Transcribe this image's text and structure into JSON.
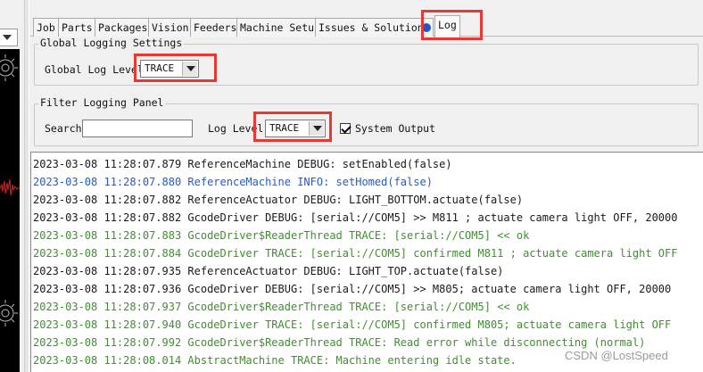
{
  "tabs": [
    {
      "label": "Job"
    },
    {
      "label": "Parts"
    },
    {
      "label": "Packages"
    },
    {
      "label": "Vision"
    },
    {
      "label": "Feeders"
    },
    {
      "label": "Machine Setup"
    },
    {
      "label": "Issues & Solutions"
    },
    {
      "label": "Log"
    }
  ],
  "global_settings": {
    "title": "Global Logging Settings",
    "log_level_label": "Global Log Level",
    "log_level_value": "TRACE"
  },
  "filter_panel": {
    "title": "Filter Logging Panel",
    "search_label": "Search",
    "search_value": "",
    "log_level_label": "Log Level:",
    "log_level_value": "TRACE",
    "system_output_label": "System Output",
    "system_output_checked": true
  },
  "colors": {
    "debug": "#1a1a1a",
    "info": "#1e5bd6",
    "trace": "#3f8f2f",
    "highlight": "#e53935",
    "status_dot": "#1f57c9"
  },
  "log_lines": [
    {
      "level": "debug",
      "text": "2023-03-08 11:28:07.879 ReferenceMachine DEBUG: setEnabled(false)"
    },
    {
      "level": "info",
      "text": "2023-03-08 11:28:07.880 ReferenceMachine INFO: setHomed(false)"
    },
    {
      "level": "debug",
      "text": "2023-03-08 11:28:07.882 ReferenceActuator DEBUG: LIGHT_BOTTOM.actuate(false)"
    },
    {
      "level": "debug",
      "text": "2023-03-08 11:28:07.882 GcodeDriver DEBUG: [serial://COM5] >> M811 ; actuate camera light OFF, 20000"
    },
    {
      "level": "trace",
      "text": "2023-03-08 11:28:07.883 GcodeDriver$ReaderThread TRACE: [serial://COM5] << ok"
    },
    {
      "level": "trace",
      "text": "2023-03-08 11:28:07.884 GcodeDriver TRACE: [serial://COM5] confirmed M811 ; actuate camera light OFF"
    },
    {
      "level": "debug",
      "text": "2023-03-08 11:28:07.935 ReferenceActuator DEBUG: LIGHT_TOP.actuate(false)"
    },
    {
      "level": "debug",
      "text": "2023-03-08 11:28:07.936 GcodeDriver DEBUG: [serial://COM5] >> M805; actuate camera light OFF, 20000"
    },
    {
      "level": "trace",
      "text": "2023-03-08 11:28:07.937 GcodeDriver$ReaderThread TRACE: [serial://COM5] << ok"
    },
    {
      "level": "trace",
      "text": "2023-03-08 11:28:07.940 GcodeDriver TRACE: [serial://COM5] confirmed M805; actuate camera light OFF"
    },
    {
      "level": "trace",
      "text": "2023-03-08 11:28:07.992 GcodeDriver$ReaderThread TRACE: Read error while disconnecting (normal)"
    },
    {
      "level": "trace",
      "text": "2023-03-08 11:28:08.014 AbstractMachine TRACE: Machine entering idle state."
    }
  ],
  "watermark": "CSDN @LostSpeed"
}
